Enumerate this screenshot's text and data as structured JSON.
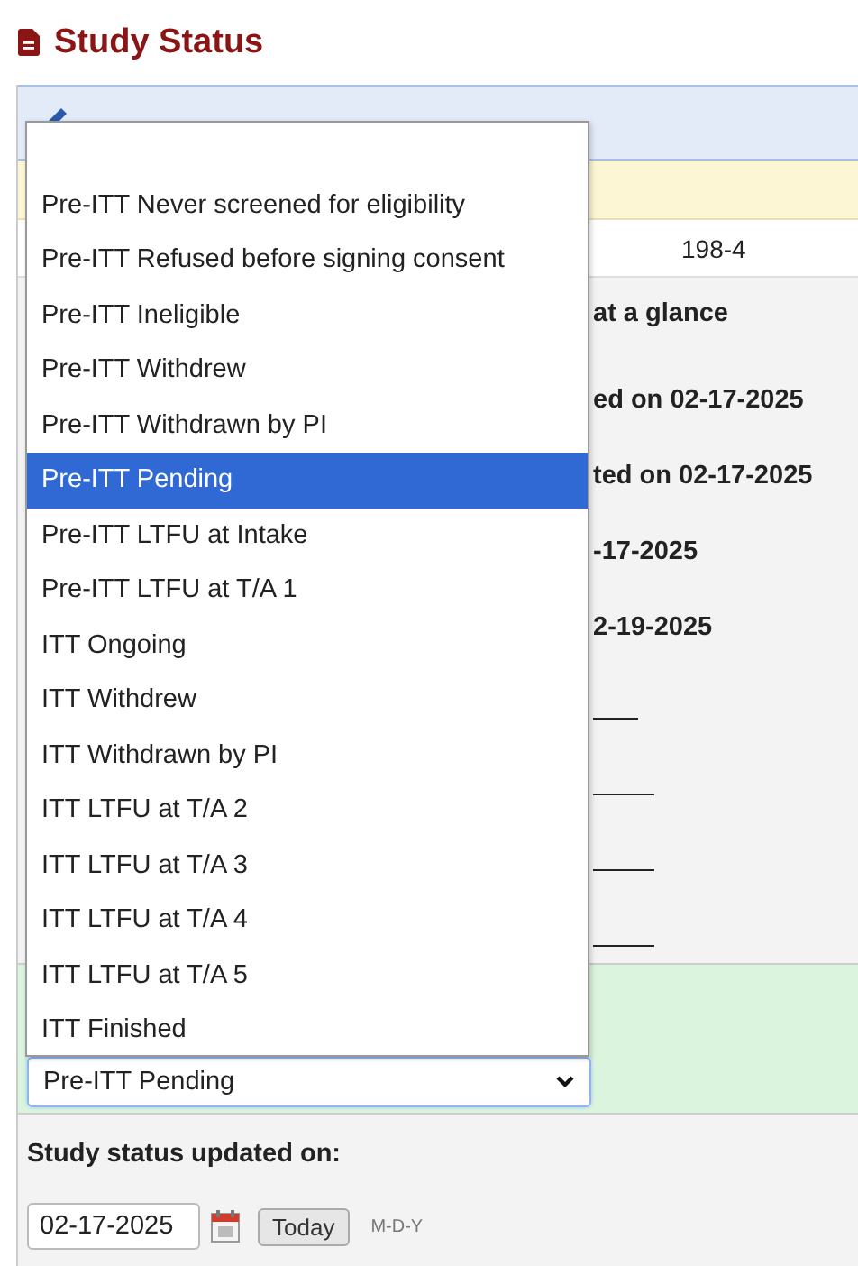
{
  "header": {
    "title": "Study Status"
  },
  "record_row": {
    "value": "198-4"
  },
  "summary_fragments": [
    {
      "kind": "heading",
      "text": "at a glance"
    },
    {
      "kind": "line",
      "text": "ed on 02-17-2025"
    },
    {
      "kind": "line",
      "text": "ted on 02-17-2025"
    },
    {
      "kind": "line",
      "text": "-17-2025"
    },
    {
      "kind": "line",
      "text": "2-19-2025"
    },
    {
      "kind": "blank"
    },
    {
      "kind": "blank"
    },
    {
      "kind": "blank"
    },
    {
      "kind": "blank"
    }
  ],
  "status_select": {
    "value": "Pre-ITT Pending",
    "expanded": true,
    "options": [
      {
        "label": "Pre-ITT Never screened for eligibility",
        "selected": false
      },
      {
        "label": "Pre-ITT Refused before signing consent",
        "selected": false
      },
      {
        "label": "Pre-ITT Ineligible",
        "selected": false
      },
      {
        "label": "Pre-ITT Withdrew",
        "selected": false
      },
      {
        "label": "Pre-ITT Withdrawn by PI",
        "selected": false
      },
      {
        "label": "Pre-ITT Pending",
        "selected": true
      },
      {
        "label": "Pre-ITT LTFU at Intake",
        "selected": false
      },
      {
        "label": "Pre-ITT LTFU at T/A 1",
        "selected": false
      },
      {
        "label": "ITT Ongoing",
        "selected": false
      },
      {
        "label": "ITT Withdrew",
        "selected": false
      },
      {
        "label": "ITT Withdrawn by PI",
        "selected": false
      },
      {
        "label": "ITT LTFU at T/A 2",
        "selected": false
      },
      {
        "label": "ITT LTFU at T/A 3",
        "selected": false
      },
      {
        "label": "ITT LTFU at T/A 4",
        "selected": false
      },
      {
        "label": "ITT LTFU at T/A 5",
        "selected": false
      },
      {
        "label": "ITT Finished",
        "selected": false
      }
    ]
  },
  "date_field": {
    "label": "Study status updated on:",
    "value": "02-17-2025",
    "today_button": "Today",
    "format_hint": "M-D-Y"
  }
}
